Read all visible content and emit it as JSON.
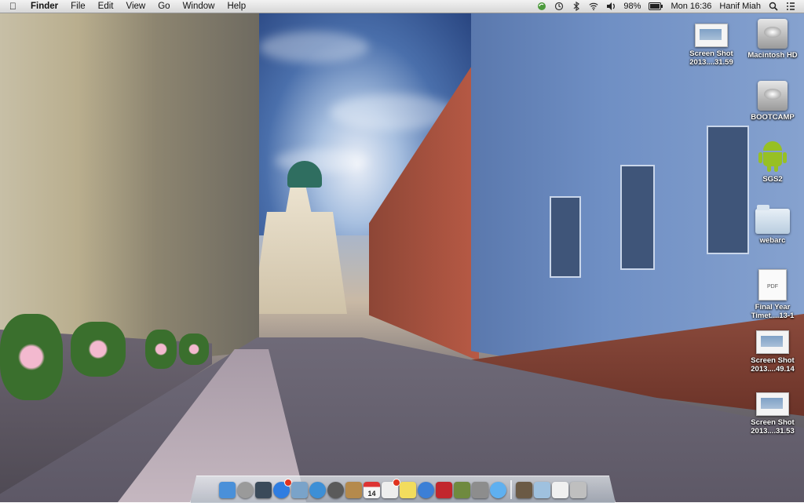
{
  "menubar": {
    "app_name": "Finder",
    "menus": [
      "File",
      "Edit",
      "View",
      "Go",
      "Window",
      "Help"
    ],
    "battery": "98%",
    "clock": "Mon 16:36",
    "user": "Hanif Miah"
  },
  "desktop_icons": [
    {
      "label": "Screen Shot 2013....31.59",
      "kind": "screenshot"
    },
    {
      "label": "Macintosh HD",
      "kind": "hard-drive"
    },
    {
      "label": "BOOTCAMP",
      "kind": "hard-drive"
    },
    {
      "label": "SGS2",
      "kind": "android"
    },
    {
      "label": "webarc",
      "kind": "folder"
    },
    {
      "label": "Final Year Timet....13-1",
      "kind": "pdf"
    },
    {
      "label": "Screen Shot 2013....49.14",
      "kind": "screenshot"
    },
    {
      "label": "Screen Shot 2013....31.53",
      "kind": "screenshot"
    }
  ],
  "pdf_icon_text": "PDF",
  "dock": {
    "calendar_day": "14",
    "items": [
      {
        "name": "finder",
        "color": "#4a90d9"
      },
      {
        "name": "launchpad",
        "color": "#9a9a9a"
      },
      {
        "name": "mission-control",
        "color": "#3a4a5a"
      },
      {
        "name": "app-store",
        "color": "#2f7de1"
      },
      {
        "name": "preview",
        "color": "#7aa3c9"
      },
      {
        "name": "safari",
        "color": "#3d8fd6"
      },
      {
        "name": "facetime",
        "color": "#5a5a5a"
      },
      {
        "name": "address-book",
        "color": "#b58a4c"
      },
      {
        "name": "calendar",
        "color": "#f5f5f5"
      },
      {
        "name": "reminders",
        "color": "#eeeeee"
      },
      {
        "name": "notes",
        "color": "#f2dc5d"
      },
      {
        "name": "itunes",
        "color": "#3c7fd6"
      },
      {
        "name": "photo-booth",
        "color": "#c2272d"
      },
      {
        "name": "iphoto",
        "color": "#6f8a3f"
      },
      {
        "name": "system-preferences",
        "color": "#8d8d8d"
      },
      {
        "name": "messages",
        "color": "#5fb0f0"
      },
      {
        "name": "downloads-stack",
        "color": "#6b5a45"
      },
      {
        "name": "applications-folder",
        "color": "#9fc1df"
      },
      {
        "name": "documents-stack",
        "color": "#f0f0f0"
      },
      {
        "name": "trash",
        "color": "#bfbfbf"
      }
    ]
  }
}
